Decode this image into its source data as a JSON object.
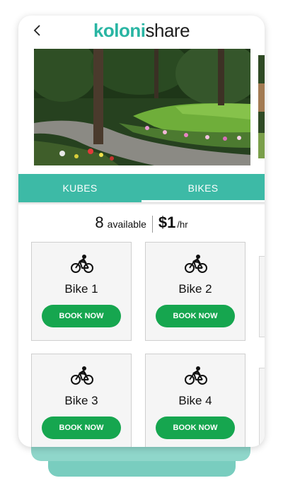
{
  "header": {
    "logo_part1": "koloni",
    "logo_part2": "share"
  },
  "tabs": [
    {
      "label": "KUBES",
      "active": false
    },
    {
      "label": "BIKES",
      "active": true
    }
  ],
  "availability": {
    "count": "8",
    "count_label": "available",
    "price": "$1",
    "price_unit": "/hr"
  },
  "bikes": [
    {
      "name": "Bike 1",
      "button_label": "BOOK NOW"
    },
    {
      "name": "Bike 2",
      "button_label": "BOOK NOW"
    },
    {
      "name": "Bike 3",
      "button_label": "BOOK NOW"
    },
    {
      "name": "Bike 4",
      "button_label": "BOOK NOW"
    }
  ],
  "colors": {
    "teal": "#3dbaa6",
    "brand_teal": "#29b5a3",
    "book_green": "#16a64f"
  },
  "icons": [
    "back-arrow-icon",
    "bike-icon"
  ]
}
